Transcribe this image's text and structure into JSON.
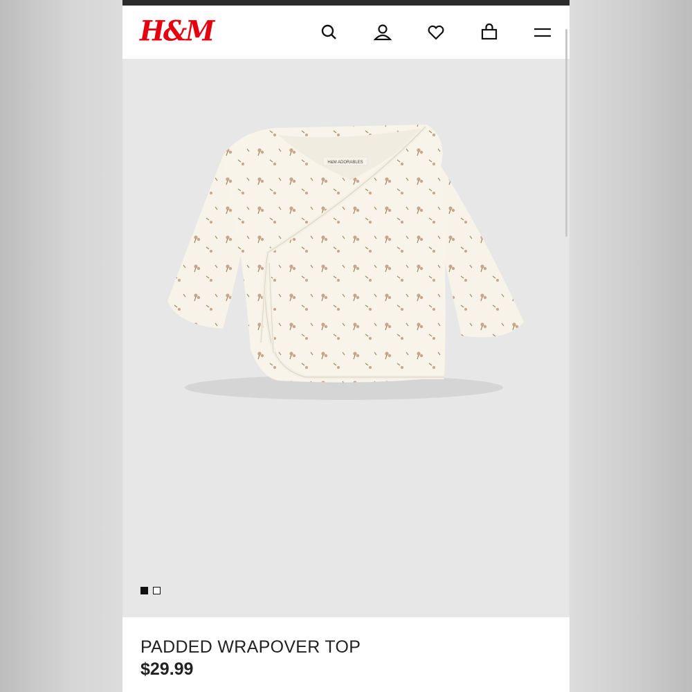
{
  "brand": {
    "logo_text": "H&M",
    "color": "#e50010"
  },
  "header": {
    "icons": [
      "search-icon",
      "account-icon",
      "favorites-heart-icon",
      "shopping-bag-icon",
      "menu-icon"
    ]
  },
  "product": {
    "image_label_text": "H&M ADORABLES",
    "carousel": {
      "count": 2,
      "active_index": 0
    },
    "name": "PADDED WRAPOVER TOP",
    "price": "$29.99"
  }
}
